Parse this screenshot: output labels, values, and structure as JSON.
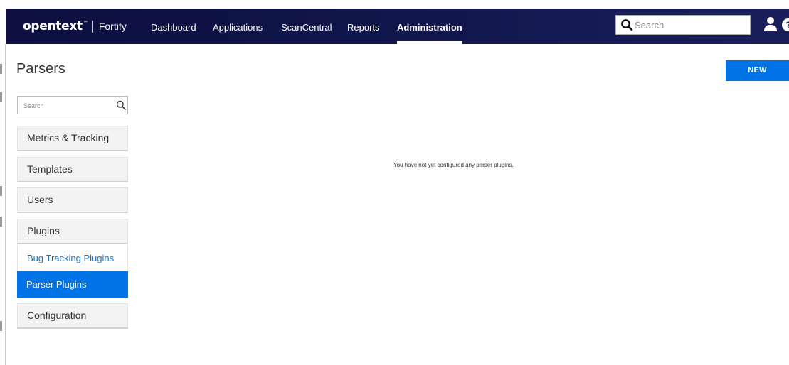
{
  "header": {
    "logo_main": "opentext",
    "logo_tm": "™",
    "product": "Fortify",
    "nav": [
      {
        "label": "Dashboard"
      },
      {
        "label": "Applications"
      },
      {
        "label": "ScanCentral"
      },
      {
        "label": "Reports"
      },
      {
        "label": "Administration",
        "active": true
      }
    ],
    "search_placeholder": "Search",
    "user_icon": "user-icon",
    "help_icon": "help-icon",
    "help_glyph": "?"
  },
  "page": {
    "title": "Parsers",
    "new_label": "NEW"
  },
  "sidebar": {
    "search_placeholder": "Search",
    "items": [
      {
        "label": "Metrics & Tracking"
      },
      {
        "label": "Templates"
      },
      {
        "label": "Users"
      },
      {
        "label": "Plugins"
      }
    ],
    "plugins_sub": [
      {
        "label": "Bug Tracking Plugins"
      },
      {
        "label": "Parser Plugins",
        "selected": true
      }
    ],
    "after": [
      {
        "label": "Configuration"
      }
    ]
  },
  "main": {
    "empty_message": "You have not yet configured any parser plugins."
  },
  "colors": {
    "nav_bg": "#10154a",
    "accent": "#0073e6",
    "link": "#1a73c9"
  }
}
